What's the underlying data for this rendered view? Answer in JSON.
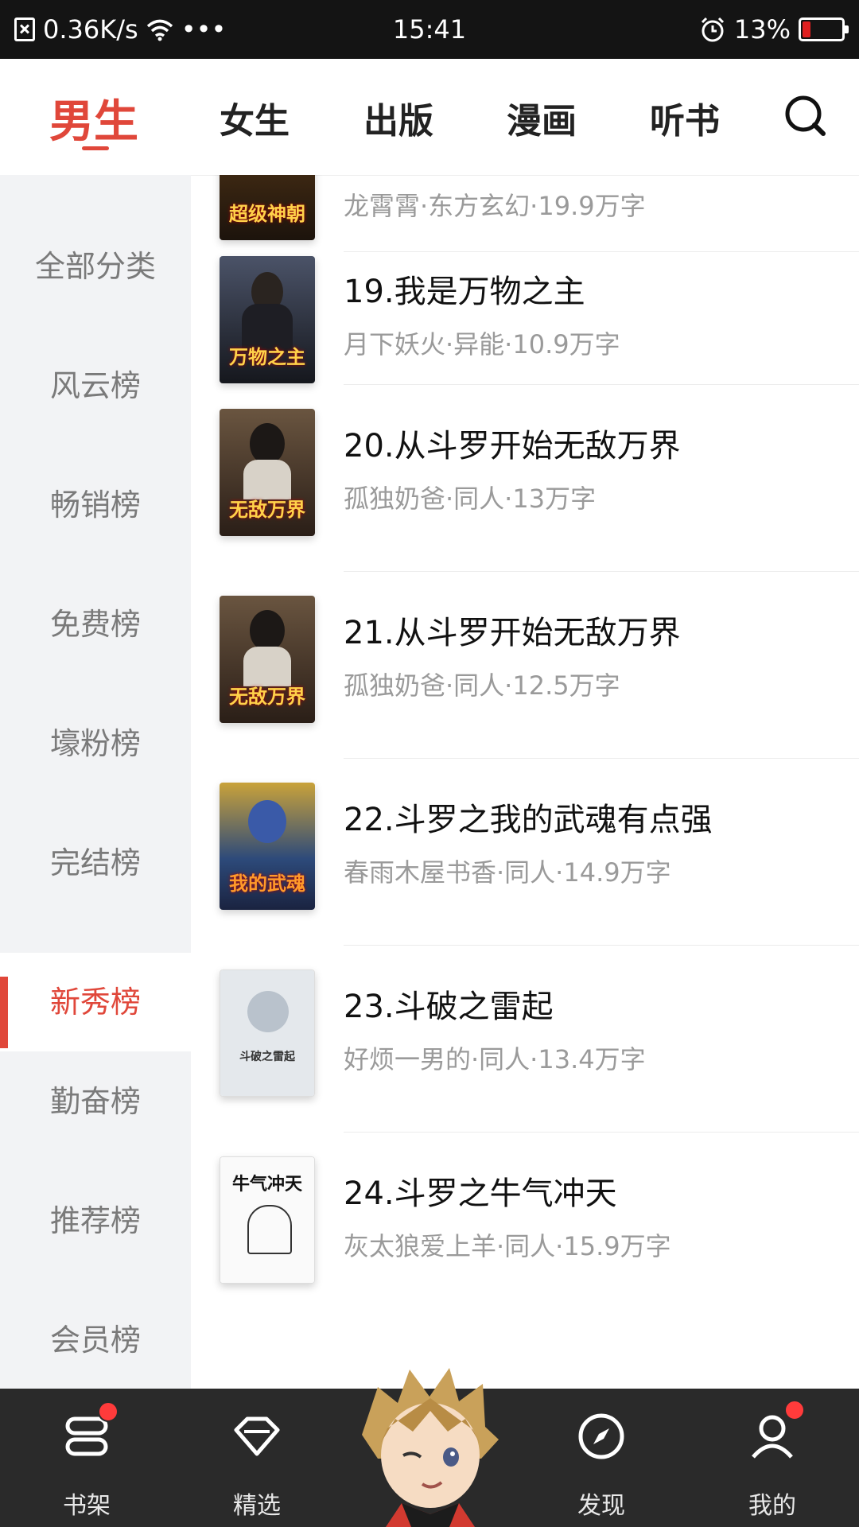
{
  "status_bar": {
    "net_speed": "0.36K/s",
    "dots": "•••",
    "time": "15:41",
    "battery": "13%",
    "battery_level": 0.13,
    "colors": {
      "background": "#141414",
      "battery_low": "#e02020"
    }
  },
  "nav": {
    "tabs": [
      "男生",
      "女生",
      "出版",
      "漫画",
      "听书"
    ],
    "active_tab": "男生",
    "accent_color": "#e0473a"
  },
  "sidebar": {
    "items": [
      "全部分类",
      "风云榜",
      "畅销榜",
      "免费榜",
      "壕粉榜",
      "完结榜",
      "新秀榜",
      "勤奋榜",
      "推荐榜",
      "会员榜"
    ],
    "active": "新秀榜"
  },
  "books": [
    {
      "title": "",
      "meta": "龙霄霄·东方玄幻·19.9万字",
      "cover_text": "超级神朝",
      "cover_color": "#3a2a18"
    },
    {
      "title": "19.我是万物之主",
      "meta": "月下妖火·异能·10.9万字",
      "cover_text": "万物之主",
      "cover_color": "#2b2f3a"
    },
    {
      "title": "20.从斗罗开始无敌万界",
      "meta": "孤独奶爸·同人·13万字",
      "cover_text": "无敌万界",
      "cover_color": "#3a3028"
    },
    {
      "title": "21.从斗罗开始无敌万界",
      "meta": "孤独奶爸·同人·12.5万字",
      "cover_text": "无敌万界",
      "cover_color": "#3a3028"
    },
    {
      "title": "22.斗罗之我的武魂有点强",
      "meta": "春雨木屋书香·同人·14.9万字",
      "cover_text": "我的武魂",
      "cover_color": "#2d4a7a"
    },
    {
      "title": "23.斗破之雷起",
      "meta": "好烦一男的·同人·13.4万字",
      "cover_text": "斗破之雷起",
      "cover_color": "#dfe3e8"
    },
    {
      "title": "24.斗罗之牛气冲天",
      "meta": "灰太狼爱上羊·同人·15.9万字",
      "cover_text": "牛气冲天",
      "cover_color": "#f7f7f7"
    }
  ],
  "bottom_bar": {
    "items": [
      {
        "label": "书架",
        "icon": "bookshelf-icon",
        "badge": true
      },
      {
        "label": "精选",
        "icon": "diamond-icon",
        "badge": false
      },
      {
        "label": "发现",
        "icon": "compass-icon",
        "badge": false
      },
      {
        "label": "我的",
        "icon": "profile-icon",
        "badge": true
      }
    ]
  }
}
